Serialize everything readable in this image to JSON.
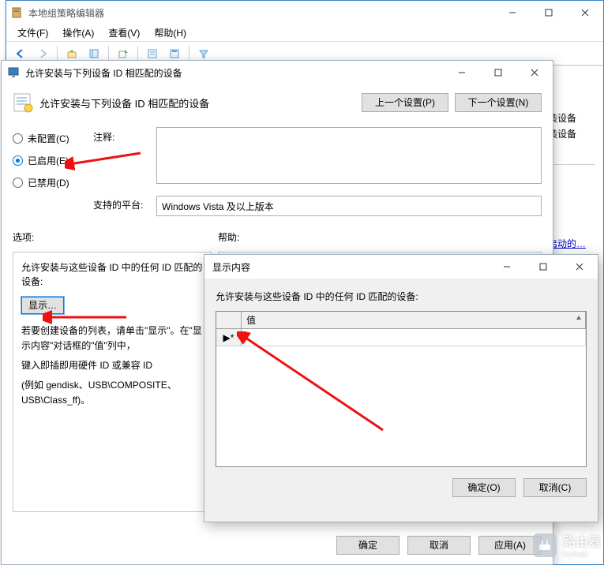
{
  "gpe": {
    "title": "本地组策略编辑器",
    "menus": {
      "file": "文件(F)",
      "action": "操作(A)",
      "view": "查看(V)",
      "help": "帮助(H)"
    }
  },
  "right": {
    "link1": "装设备",
    "link2": "装设备",
    "link3": "启动的…"
  },
  "settings": {
    "title": "允许安装与下列设备 ID 相匹配的设备",
    "headerText": "允许安装与下列设备 ID 相匹配的设备",
    "prevBtn": "上一个设置(P)",
    "nextBtn": "下一个设置(N)",
    "radio": {
      "notConfigured": "未配置(C)",
      "enabled": "已启用(E)",
      "disabled": "已禁用(D)"
    },
    "commentLabel": "注释:",
    "platformLabel": "支持的平台:",
    "platformValue": "Windows Vista 及以上版本",
    "optionsLabel": "选项:",
    "helpLabel": "帮助:",
    "leftPanel": {
      "listLabel": "允许安装与这些设备 ID 中的任何 ID 匹配的设备:",
      "showBtn": "显示…",
      "para1": "若要创建设备的列表，请单击\"显示\"。在\"显示内容\"对话框的\"值\"列中，",
      "para2": "键入即插即用硬件 ID 或兼容 ID",
      "para3": "(例如 gendisk、USB\\COMPOSITE、USB\\Class_ff)。"
    },
    "okBtn": "确定",
    "cancelBtn": "取消",
    "applyBtn": "应用(A)"
  },
  "show": {
    "title": "显示内容",
    "label": "允许安装与这些设备 ID 中的任何 ID 匹配的设备:",
    "colHeader": "值",
    "rowMarker": "▶*",
    "okBtn": "确定(O)",
    "cancelBtn": "取消(C)"
  },
  "watermark": {
    "big": "路由器",
    "small": "luyouqi"
  }
}
